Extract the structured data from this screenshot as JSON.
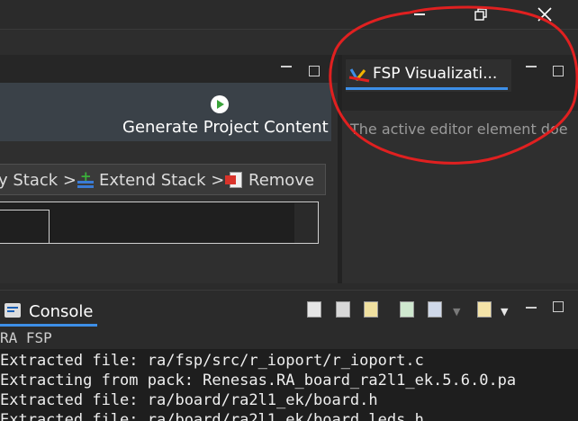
{
  "window": {
    "controls": {
      "minimize_icon": "minimize-icon",
      "restore_icon": "restore-icon",
      "close_icon": "close-icon"
    }
  },
  "editor": {
    "generate_label": "Generate Project Content",
    "stack_buttons": {
      "view_stack": "y Stack >",
      "extend_stack": "Extend Stack >",
      "remove": "Remove"
    }
  },
  "right_panel": {
    "tab_label": "FSP Visualizati...",
    "message": "The active editor element doe"
  },
  "console": {
    "tab_label": "Console",
    "title": "RA FSP",
    "lines": [
      "Extracted file: ra/fsp/src/r_ioport/r_ioport.c",
      "Extracting from pack: Renesas.RA_board_ra2l1_ek.5.6.0.pa",
      "Extracted file: ra/board/ra2l1_ek/board.h",
      "Extracted file: ra/board/ra2l1_ek/board_leds.h"
    ]
  },
  "colors": {
    "accent_blue": "#3d8fe8",
    "annotation_red": "#e02020",
    "generate_green": "#3aa33a"
  }
}
